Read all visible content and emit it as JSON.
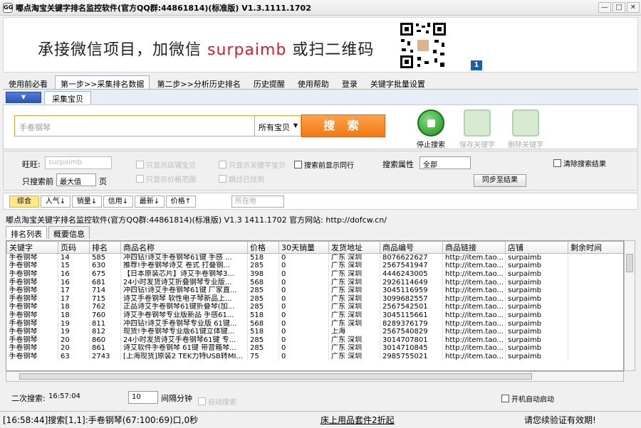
{
  "window": {
    "app_icon": "GG",
    "title": "嘟点淘宝关键字排名监控软件(官方QQ群:44861814)(标准版) V1.3.1111.1702"
  },
  "banner": {
    "text_before": "承接微信项目，加微信 ",
    "text_wechat": "surpaimb",
    "text_after": " 或扫二维码",
    "badge": "1"
  },
  "menu": {
    "items": [
      "使用前必看",
      "第一步>>采集排名数据",
      "第二步>>分析历史排名",
      "历史提醒",
      "使用帮助",
      "登录",
      "关键字批量设置"
    ]
  },
  "subtabs": {
    "dropdown_arrow": "▼",
    "collect": "采集宝贝"
  },
  "search": {
    "keyword_value": "手卷钢琴",
    "scope_value": "所有宝贝",
    "scope_arrow": "▼",
    "search_label": "搜 索",
    "stop_label": "停止搜索",
    "save_label": "保存关键字",
    "delete_label": "删除关键字"
  },
  "filters": {
    "shop_label": "旺旺:",
    "shop_value": "surpaimb",
    "only_search_label": "只搜索前",
    "max_value": "最大值",
    "pages_label": "页",
    "opt1": "只显示店铺宝贝",
    "opt2": "只显示价格范围",
    "opt3": "只显示关键字宝贝",
    "opt4": "跳过已找到",
    "opt5": "搜索前显示同行",
    "attr_label": "搜索属性",
    "attr_value": "全部",
    "sync_button": "同步至结果",
    "clear_label": "清除搜索结果"
  },
  "sort": {
    "buttons": [
      "综合",
      "人气↓",
      "销量↓",
      "信用↓",
      "最新↓",
      "价格↑"
    ],
    "location_placeholder": "所在地"
  },
  "info_line": "嘟点淘宝关键字排名监控软件(官方QQ群:44861814)(标准版) V1.3 1411.1702   官方网站: http://dofcw.cn/",
  "list_tabs": [
    "排名列表",
    "概要信息"
  ],
  "table": {
    "headers": [
      "关键字",
      "页码",
      "排名",
      "商品名称",
      "价格",
      "30天销量",
      "发货地址",
      "商品编号",
      "商品链接",
      "店铺",
      "剩余时间"
    ],
    "rows": [
      [
        "手卷钢琴",
        "14",
        "585",
        "冲四钻!诗艾手卷钢琴61键 手感 ...",
        "518",
        "0",
        "广东 深圳",
        "8076622627",
        "http://item.tao...",
        "surpaimb",
        ""
      ],
      [
        "手卷钢琴",
        "15",
        "630",
        "推荐!手卷钢琴诗艾 卷式 打叠钢...",
        "285",
        "0",
        "广东 深圳",
        "2567541947",
        "http://item.tao...",
        "surpaimb",
        ""
      ],
      [
        "手卷钢琴",
        "16",
        "675",
        "【日本原装芯片】诗艾手卷钢琴3...",
        "398",
        "0",
        "广东 深圳",
        "4446243005",
        "http://item.tao...",
        "surpaimb",
        ""
      ],
      [
        "手卷钢琴",
        "16",
        "681",
        "24小时发货诗艾折叠钢琴专业版...",
        "568",
        "0",
        "广东 深圳",
        "2926114649",
        "http://item.tao...",
        "surpaimb",
        ""
      ],
      [
        "手卷钢琴",
        "17",
        "714",
        "冲四钻!诗艾手卷钢琴61键 厂家直...",
        "285",
        "0",
        "广东 深圳",
        "3045116959",
        "http://item.tao...",
        "surpaimb",
        ""
      ],
      [
        "手卷钢琴",
        "17",
        "715",
        "诗艾手卷钢琴 软性电子琴新品上...",
        "285",
        "0",
        "广东 深圳",
        "3099682557",
        "http://item.tao...",
        "surpaimb",
        ""
      ],
      [
        "手卷钢琴",
        "18",
        "762",
        "正品诗艾手卷钢琴61键折叠琴(加...",
        "285",
        "0",
        "广东 深圳",
        "2567542501",
        "http://item.tao...",
        "surpaimb",
        ""
      ],
      [
        "手卷钢琴",
        "18",
        "760",
        "诗艾手卷钢琴专业版新品 手感61...",
        "518",
        "0",
        "广东 深圳",
        "3045115661",
        "http://item.tao...",
        "surpaimb",
        ""
      ],
      [
        "手卷钢琴",
        "19",
        "811",
        "冲四钻!诗艾手卷钢琴专业版 61键...",
        "568",
        "0",
        "广东 深圳",
        "8289376179",
        "http://item.tao...",
        "surpaimb",
        ""
      ],
      [
        "手卷钢琴",
        "19",
        "812",
        "现货!手卷钢琴专业版61键立体键...",
        "518",
        "0",
        "上海",
        "2567540829",
        "http://item.tao...",
        "surpaimb",
        ""
      ],
      [
        "手卷钢琴",
        "20",
        "860",
        "24小时发货诗艾手卷钢琴61键 专...",
        "285",
        "0",
        "广东 深圳",
        "3014707801",
        "http://item.tao...",
        "surpaimb",
        ""
      ],
      [
        "手卷钢琴",
        "20",
        "861",
        "诗艾软件手卷钢琴 61键 带音箱琴...",
        "285",
        "0",
        "广东 深圳",
        "3014710845",
        "http://item.tao...",
        "surpaimb",
        ""
      ],
      [
        "手卷钢琴",
        "63",
        "2743",
        "[上海现货]原装2 TEK力特USB转MI...",
        "75",
        "0",
        "广东 深圳",
        "2985755021",
        "http://item.tao...",
        "surpaimb",
        ""
      ]
    ]
  },
  "bottom": {
    "second_search_label": "二次搜索:",
    "second_search_time": "16:57:04",
    "interval_value": "10",
    "interval_label": "间隔分钟",
    "auto_search_label": "自动搜索",
    "autostart_label": "开机自动启动"
  },
  "status": {
    "left": "[16:58:44]搜索[1,1]:手卷钢琴(67:100:69)口,0秒",
    "center": "床上用品套件2折起",
    "right": "请您续验证有效期!"
  }
}
